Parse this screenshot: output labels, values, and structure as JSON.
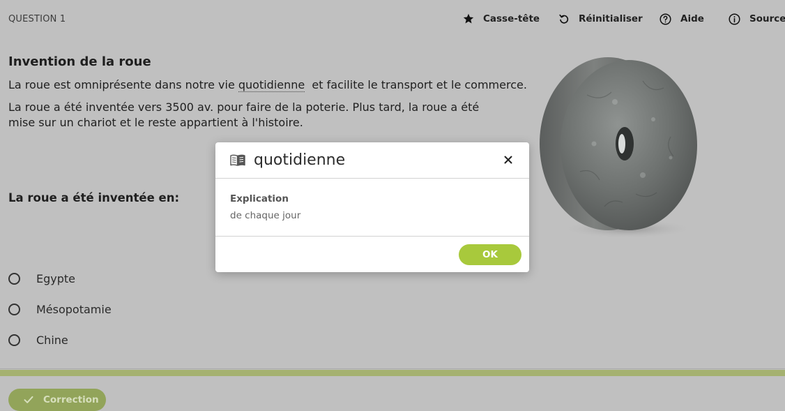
{
  "header": {
    "question_label": "QUESTION 1",
    "tools": [
      {
        "label": "Casse-tête",
        "icon": "star-icon"
      },
      {
        "label": "Réinitialiser",
        "icon": "reset-icon"
      },
      {
        "label": "Aide",
        "icon": "help-icon"
      },
      {
        "label": "Source",
        "icon": "info-icon"
      }
    ]
  },
  "content": {
    "title": "Invention de la roue",
    "paragraph1": {
      "before": "La roue est omniprésente dans notre vie ",
      "term": "quotidienne",
      "after": "  et facilite le transport et le commerce."
    },
    "paragraph2": "La roue a été inventée vers 3500 av. pour faire de la poterie. Plus tard, la roue a été mise sur un chariot et le reste appartient à l'histoire.",
    "image_subject": "stone-wheel",
    "question": "La roue a été inventée en:",
    "options": [
      "Egypte",
      "Mésopotamie",
      "Chine"
    ]
  },
  "footer": {
    "correction_label": "Correction"
  },
  "modal": {
    "title": "quotidienne",
    "label": "Explication",
    "text": "de chaque jour",
    "ok_label": "OK"
  },
  "colors": {
    "overlay_background": "#c0c0c0",
    "accent_green": "#a8c93c",
    "correction_button": "#92a45a",
    "footer_stripe": "#a5b170"
  }
}
